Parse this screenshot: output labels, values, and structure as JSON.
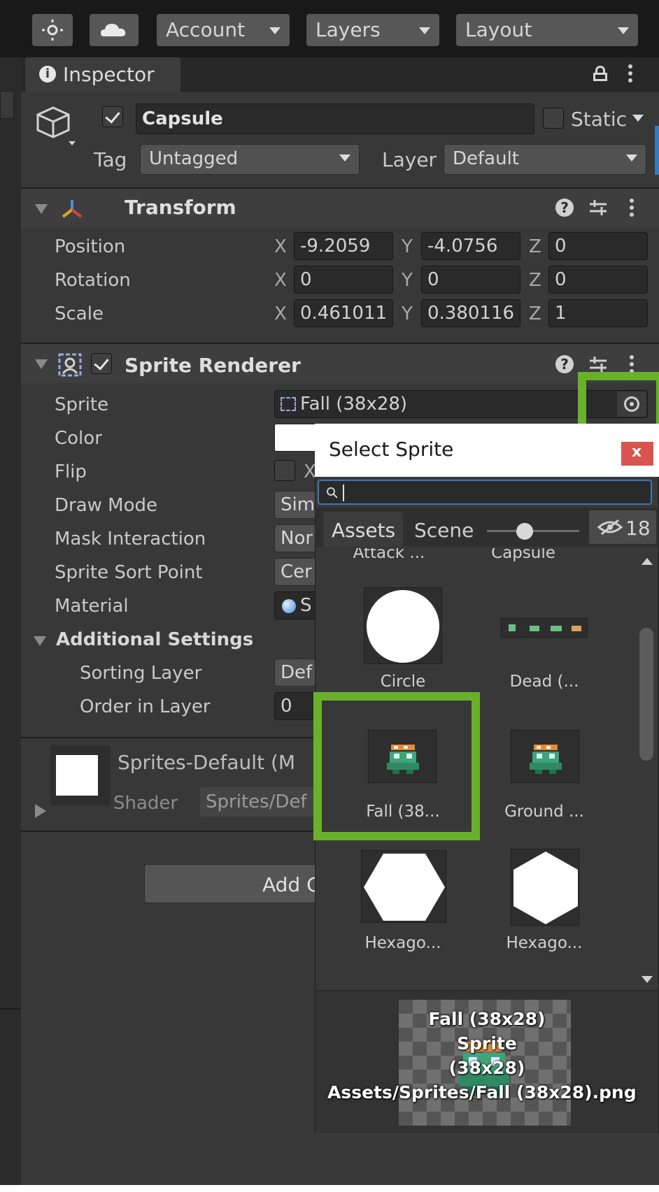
{
  "toolbar": {
    "account_label": "Account",
    "layers_label": "Layers",
    "layout_label": "Layout"
  },
  "inspector": {
    "tab_label": "Inspector",
    "object_name": "Capsule",
    "static_label": "Static",
    "tag_label": "Tag",
    "tag_value": "Untagged",
    "layer_label": "Layer",
    "layer_value": "Default"
  },
  "transform": {
    "title": "Transform",
    "rows": [
      {
        "label": "Position",
        "x": "-9.2059",
        "y": "-4.0756",
        "z": "0"
      },
      {
        "label": "Rotation",
        "x": "0",
        "y": "0",
        "z": "0"
      },
      {
        "label": "Scale",
        "x": "0.461011",
        "y": "0.380116",
        "z": "1"
      }
    ],
    "axis_x": "X",
    "axis_y": "Y",
    "axis_z": "Z"
  },
  "sprite_renderer": {
    "title": "Sprite Renderer",
    "sprite_label": "Sprite",
    "sprite_value": "Fall (38x28)",
    "color_label": "Color",
    "flip_label": "Flip",
    "flip_x": "X",
    "draw_mode_label": "Draw Mode",
    "draw_mode_value": "Sim",
    "mask_label": "Mask Interaction",
    "mask_value": "Nor",
    "sort_point_label": "Sprite Sort Point",
    "sort_point_value": "Cer",
    "material_label": "Material",
    "material_value": "S",
    "additional_label": "Additional Settings",
    "sorting_layer_label": "Sorting Layer",
    "sorting_layer_value": "Def",
    "order_label": "Order in Layer",
    "order_value": "0"
  },
  "material_section": {
    "name": "Sprites-Default (M",
    "shader_label": "Shader",
    "shader_value": "Sprites/Def"
  },
  "add_component_label": "Add C",
  "picker": {
    "title": "Select Sprite",
    "close": "x",
    "search_value": "",
    "tab_assets": "Assets",
    "tab_scene": "Scene",
    "hidden_count": "18",
    "zoom_level": 0.4,
    "top_labels": [
      "Attack ...",
      "Capsule"
    ],
    "tiles": [
      {
        "label": "Circle",
        "icon": "circle-sprite"
      },
      {
        "label": "Dead (...",
        "icon": "dead-sprite-sheet"
      },
      {
        "label": "Fall (38...",
        "icon": "fall-sprite"
      },
      {
        "label": "Ground ...",
        "icon": "ground-sprite"
      },
      {
        "label": "Hexago...",
        "icon": "hexagon-flat-sprite"
      },
      {
        "label": "Hexago...",
        "icon": "hexagon-pointy-sprite"
      }
    ],
    "preview": {
      "line1": "Fall (38x28)",
      "line2": "Sprite",
      "line3": "(38x28)",
      "line4": "Assets/Sprites/Fall (38x28).png"
    }
  },
  "colors": {
    "panel": "#383838",
    "highlight": "#6ab12b",
    "close_button": "#d9534f"
  }
}
